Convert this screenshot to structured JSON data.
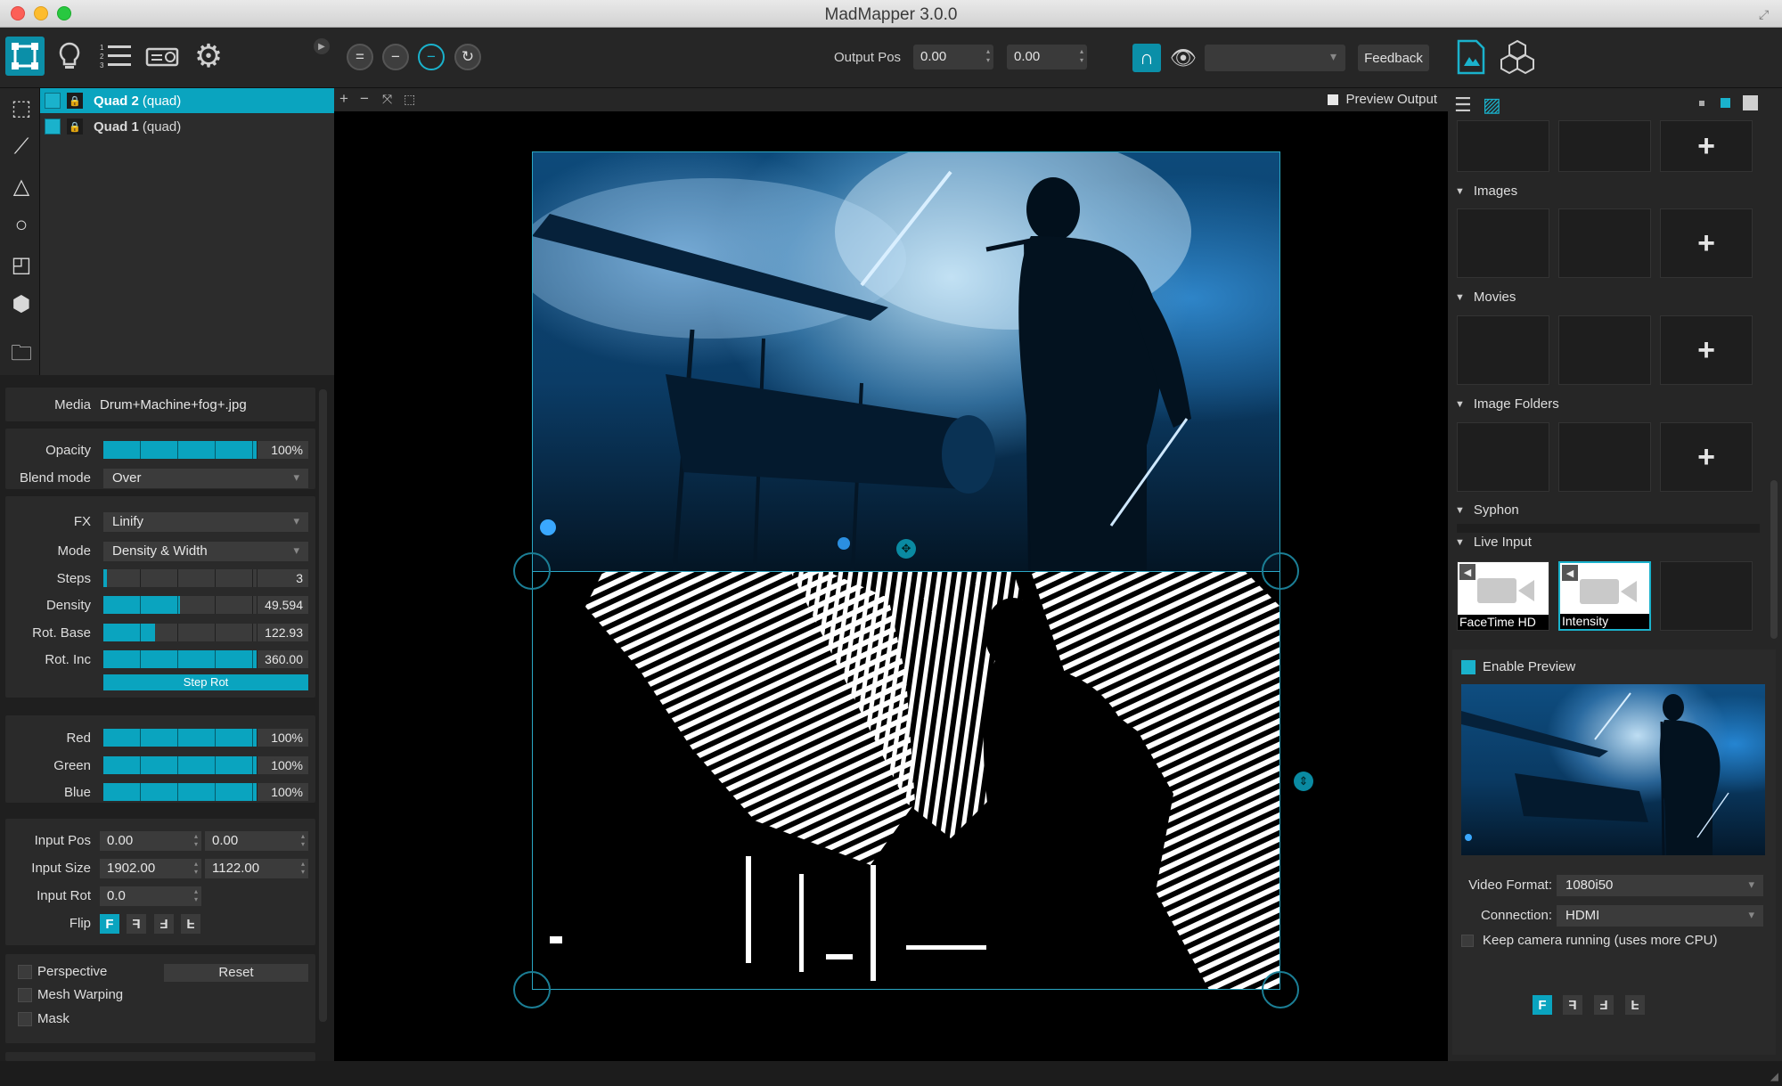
{
  "window": {
    "title": "MadMapper 3.0.0"
  },
  "toolbar": {
    "output_pos_label": "Output Pos",
    "output_pos_x": "0.00",
    "output_pos_y": "0.00",
    "feedback_label": "Feedback",
    "icons": [
      "surface-mode-icon",
      "light-bulb-icon",
      "list-icon",
      "projector-icon",
      "gear-icon",
      "equal-icon",
      "minus-icon",
      "minus-circle-icon",
      "rotate-icon",
      "magnet-icon",
      "eye-icon",
      "output-file-icon",
      "cubes-icon"
    ],
    "accent_color": "#0aa4bf"
  },
  "surfaces": [
    {
      "name": "Quad 2",
      "kind": "(quad)",
      "selected": true
    },
    {
      "name": "Quad 1",
      "kind": "(quad)",
      "selected": false
    }
  ],
  "props": {
    "media_label": "Media",
    "media_value": "Drum+Machine+fog+.jpg",
    "opacity_label": "Opacity",
    "opacity_value": "100%",
    "opacity_fill": 1.0,
    "blend_label": "Blend mode",
    "blend_value": "Over",
    "fx_label": "FX",
    "fx_value": "Linify",
    "mode_label": "Mode",
    "mode_value": "Density & Width",
    "steps_label": "Steps",
    "steps_value": "3",
    "steps_fill": 0.02,
    "density_label": "Density",
    "density_value": "49.594",
    "density_fill": 0.5,
    "rotbase_label": "Rot. Base",
    "rotbase_value": "122.93",
    "rotbase_fill": 0.34,
    "rotinc_label": "Rot. Inc",
    "rotinc_value": "360.00",
    "rotinc_fill": 1.0,
    "steprot_label": "Step Rot",
    "red_label": "Red",
    "red_value": "100%",
    "green_label": "Green",
    "green_value": "100%",
    "blue_label": "Blue",
    "blue_value": "100%",
    "inputpos_label": "Input Pos",
    "inputpos_x": "0.00",
    "inputpos_y": "0.00",
    "inputsize_label": "Input Size",
    "inputsize_w": "1902.00",
    "inputsize_h": "1122.00",
    "inputrot_label": "Input Rot",
    "inputrot_value": "0.0",
    "flip_label": "Flip",
    "flip_buttons": [
      "F",
      "F",
      "F",
      "F"
    ],
    "perspective_label": "Perspective",
    "reset_label": "Reset",
    "meshwarp_label": "Mesh Warping",
    "mask_label": "Mask"
  },
  "canvas": {
    "preview_output_label": "Preview Output",
    "bar_icons": [
      "plus-icon",
      "minus-icon",
      "fit-icon",
      "select-icon"
    ]
  },
  "media_browser": {
    "sections": [
      "Images",
      "Movies",
      "Image Folders",
      "Syphon",
      "Live Input"
    ],
    "add_symbol": "+",
    "live_inputs": [
      {
        "label": "FaceTime HD",
        "selected": false
      },
      {
        "label": "Intensity",
        "selected": true
      }
    ]
  },
  "live_props": {
    "enable_preview_label": "Enable Preview",
    "video_format_label": "Video Format:",
    "video_format_value": "1080i50",
    "connection_label": "Connection:",
    "connection_value": "HDMI",
    "keep_running_label": "Keep camera running (uses more CPU)",
    "flip_buttons": [
      "F",
      "F",
      "F",
      "F"
    ]
  }
}
